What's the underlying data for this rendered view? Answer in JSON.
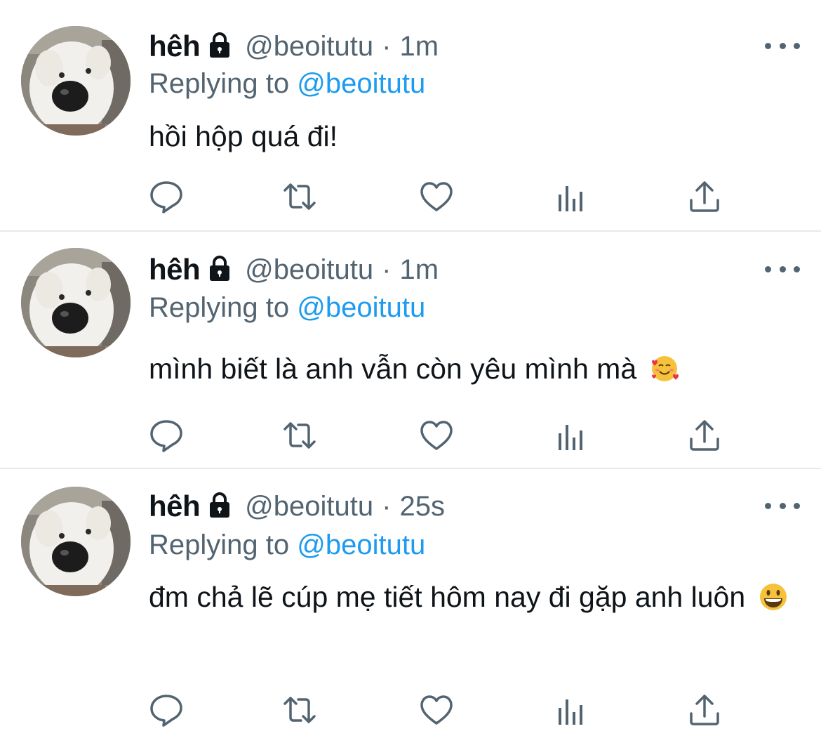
{
  "tweets": [
    {
      "name": "hêh",
      "handle": "@beoitutu",
      "separator": "·",
      "time": "1m",
      "replying_prefix": "Replying to",
      "replying_to": "@beoitutu",
      "text": "hồi hộp quá đi!",
      "emoji": ""
    },
    {
      "name": "hêh",
      "handle": "@beoitutu",
      "separator": "·",
      "time": "1m",
      "replying_prefix": "Replying to",
      "replying_to": "@beoitutu",
      "text": "mình biết là anh vẫn còn yêu mình mà",
      "emoji": "smiling-face-with-hearts"
    },
    {
      "name": "hêh",
      "handle": "@beoitutu",
      "separator": "·",
      "time": "25s",
      "replying_prefix": "Replying to",
      "replying_to": "@beoitutu",
      "text": "đm chả lẽ cúp mẹ tiết hôm nay đi gặp anh luôn",
      "emoji": "grinning-face"
    }
  ],
  "colors": {
    "text": "#0f1419",
    "secondary": "#536471",
    "link": "#1d9bf0",
    "divider": "#e6e9ec"
  },
  "icons": [
    "lock-icon",
    "more-icon",
    "reply-icon",
    "retweet-icon",
    "like-icon",
    "analytics-icon",
    "share-icon"
  ]
}
